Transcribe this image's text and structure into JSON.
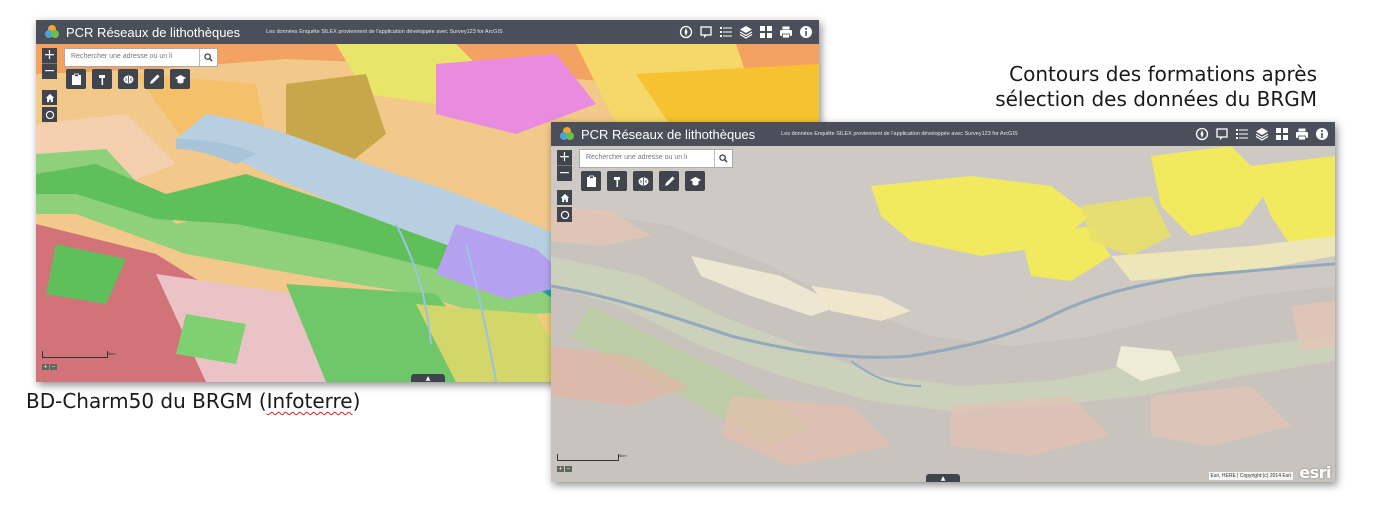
{
  "captions": {
    "right_line1": "Contours des formations après",
    "right_line2": "sélection des données du BRGM",
    "left_main": "BD-Charm50 du BRGM (",
    "left_underlined": "Infoterre",
    "left_end": ")"
  },
  "app": {
    "title": "PCR Réseaux de lithothèques",
    "subtitle": "Les données Enquête SILEX proviennent de l'application développée avec Survey123 for ArcGIS",
    "search_placeholder": "Rechercher une adresse ou un li",
    "zoom_in": "+",
    "zoom_out": "−",
    "attribution": "Esri, HERE | Copyright:(c) 2014 Esri",
    "esri_logo": "esri",
    "scale_label": "5km",
    "header_icons": [
      "compass-icon",
      "legend-icon",
      "list-icon",
      "layers-icon",
      "grid-icon",
      "print-icon",
      "info-icon"
    ],
    "tool_icons": [
      "clipboard-icon",
      "hammer-icon",
      "brain-icon",
      "pen-icon",
      "graduation-icon"
    ],
    "header_color": "#4a4f59"
  }
}
